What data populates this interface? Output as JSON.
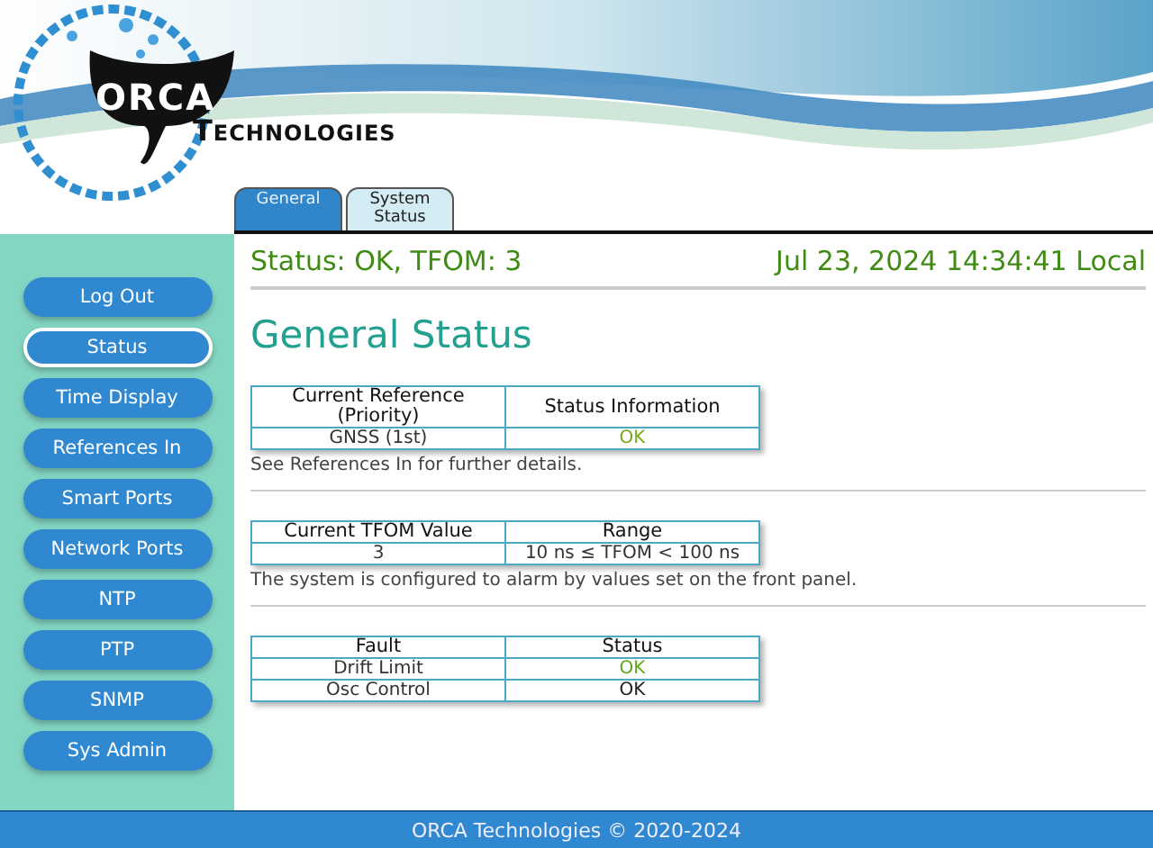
{
  "logo": {
    "name": "ORCA",
    "subtitle": "TECHNOLOGIES"
  },
  "tabs": [
    {
      "label": "General",
      "selected": true
    },
    {
      "label": "System Status",
      "selected": false
    }
  ],
  "sidebar": {
    "items": [
      {
        "label": "Log Out",
        "selected": false
      },
      {
        "label": "Status",
        "selected": true
      },
      {
        "label": "Time Display",
        "selected": false
      },
      {
        "label": "References In",
        "selected": false
      },
      {
        "label": "Smart Ports",
        "selected": false
      },
      {
        "label": "Network Ports",
        "selected": false
      },
      {
        "label": "NTP",
        "selected": false
      },
      {
        "label": "PTP",
        "selected": false
      },
      {
        "label": "SNMP",
        "selected": false
      },
      {
        "label": "Sys Admin",
        "selected": false
      }
    ]
  },
  "status_line": {
    "status": "Status: OK, TFOM: 3",
    "datetime": "Jul 23, 2024 14:34:41 Local"
  },
  "heading": "General Status",
  "sections": [
    {
      "columns": [
        "Current Reference (Priority)",
        "Status Information"
      ],
      "rows": [
        [
          {
            "text": "GNSS (1st)"
          },
          {
            "text": "OK",
            "color": "#7aa81e"
          }
        ]
      ],
      "note": "See References In for further details."
    },
    {
      "columns": [
        "Current TFOM Value",
        "Range"
      ],
      "rows": [
        [
          {
            "text": "3"
          },
          {
            "text": "10 ns ≤ TFOM < 100 ns"
          }
        ]
      ],
      "note": "The system is configured to alarm by values set on the front panel."
    },
    {
      "columns": [
        "Fault",
        "Status"
      ],
      "rows": [
        [
          {
            "text": "Drift Limit"
          },
          {
            "text": "OK",
            "color": "#5fa81e"
          }
        ],
        [
          {
            "text": "Osc Control"
          },
          {
            "text": "OK",
            "color": "#222222"
          }
        ]
      ]
    }
  ],
  "footer": "ORCA Technologies © 2020-2024"
}
